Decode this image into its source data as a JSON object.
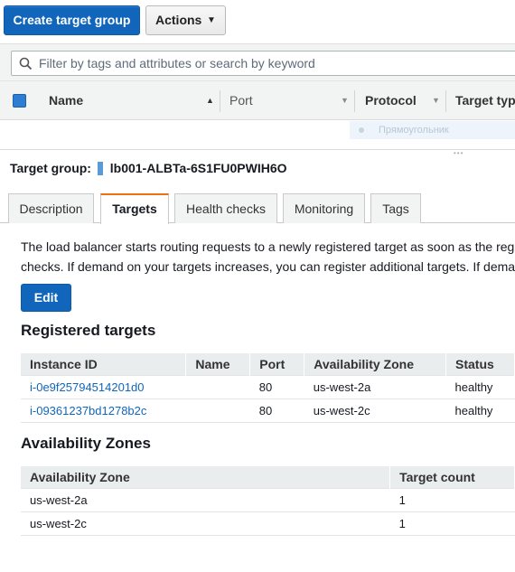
{
  "toolbar": {
    "create_label": "Create target group",
    "actions_label": "Actions"
  },
  "filter": {
    "placeholder": "Filter by tags and attributes or search by keyword"
  },
  "list_header": {
    "name": "Name",
    "port": "Port",
    "protocol": "Protocol",
    "target_type": "Target type"
  },
  "ghost_row_text": "Прямоугольник",
  "target_group": {
    "label": "Target group:",
    "name": "lb001-ALBTa-6S1FU0PWIH6O"
  },
  "tabs": [
    {
      "label": "Description",
      "active": false
    },
    {
      "label": "Targets",
      "active": true
    },
    {
      "label": "Health checks",
      "active": false
    },
    {
      "label": "Monitoring",
      "active": false
    },
    {
      "label": "Tags",
      "active": false
    }
  ],
  "description": {
    "line1": "The load balancer starts routing requests to a newly registered target as soon as the reg",
    "line2": "checks. If demand on your targets increases, you can register additional targets. If dema"
  },
  "edit_label": "Edit",
  "registered_targets": {
    "title": "Registered targets",
    "columns": [
      "Instance ID",
      "Name",
      "Port",
      "Availability Zone",
      "Status"
    ],
    "rows": [
      {
        "instance_id": "i-0e9f25794514201d0",
        "name": "",
        "port": "80",
        "zone": "us-west-2a",
        "status": "healthy"
      },
      {
        "instance_id": "i-09361237bd1278b2c",
        "name": "",
        "port": "80",
        "zone": "us-west-2c",
        "status": "healthy"
      }
    ]
  },
  "availability_zones": {
    "title": "Availability Zones",
    "columns": [
      "Availability Zone",
      "Target count"
    ],
    "rows": [
      {
        "zone": "us-west-2a",
        "count": "1"
      },
      {
        "zone": "us-west-2c",
        "count": "1"
      }
    ]
  },
  "colors": {
    "primary": "#1166bb",
    "tab_accent": "#ec7211",
    "link": "#1166bb"
  }
}
